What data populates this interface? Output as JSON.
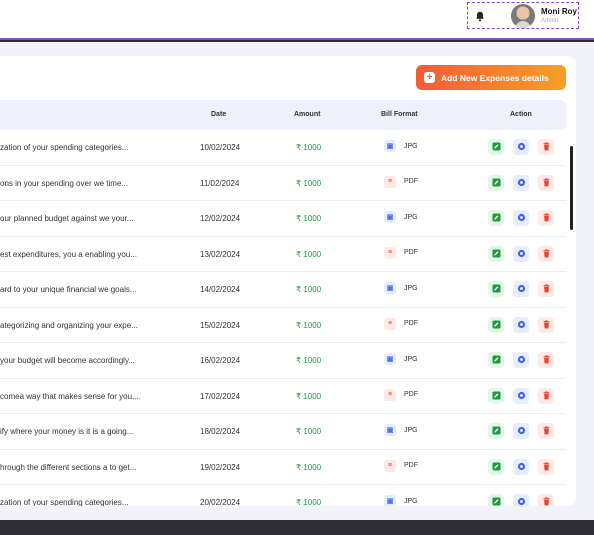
{
  "user": {
    "name": "Moni Roy",
    "role": "Admin"
  },
  "add_button": {
    "label": "Add New Expenses details"
  },
  "columns": {
    "date": "Date",
    "amount": "Amount",
    "bill_format": "Bill Format",
    "action": "Action"
  },
  "colors": {
    "accent": "#7c4ddb",
    "button_start": "#f55b35",
    "button_end": "#f5a025",
    "amount": "#1e9a3d"
  },
  "rows": [
    {
      "desc": "zation of your spending categories...",
      "date": "10/02/2024",
      "amount": "₹ 1000",
      "format": "JPG"
    },
    {
      "desc": "ons in your spending over we time...",
      "date": "11/02/2024",
      "amount": "₹ 1000",
      "format": "PDF"
    },
    {
      "desc": "our planned budget against we your...",
      "date": "12/02/2024",
      "amount": "₹ 1000",
      "format": "JPG"
    },
    {
      "desc": "est expenditures, you a enabling you...",
      "date": "13/02/2024",
      "amount": "₹ 1000",
      "format": "PDF"
    },
    {
      "desc": "ard to your unique financial we goals...",
      "date": "14/02/2024",
      "amount": "₹ 1000",
      "format": "JPG"
    },
    {
      "desc": "ategorizing and organizing your expe...",
      "date": "15/02/2024",
      "amount": "₹ 1000",
      "format": "PDF"
    },
    {
      "desc": " your budget will become accordingly...",
      "date": "16/02/2024",
      "amount": "₹ 1000",
      "format": "JPG"
    },
    {
      "desc": "comea way that makes sense for you....",
      "date": "17/02/2024",
      "amount": "₹ 1000",
      "format": "PDF"
    },
    {
      "desc": "ify where your money is it is a going...",
      "date": "18/02/2024",
      "amount": "₹ 1000",
      "format": "JPG"
    },
    {
      "desc": "hrough the different sections a to get...",
      "date": "19/02/2024",
      "amount": "₹ 1000",
      "format": "PDF"
    },
    {
      "desc": "zation of your spending categories...",
      "date": "20/02/2024",
      "amount": "₹ 1000",
      "format": "JPG"
    }
  ]
}
